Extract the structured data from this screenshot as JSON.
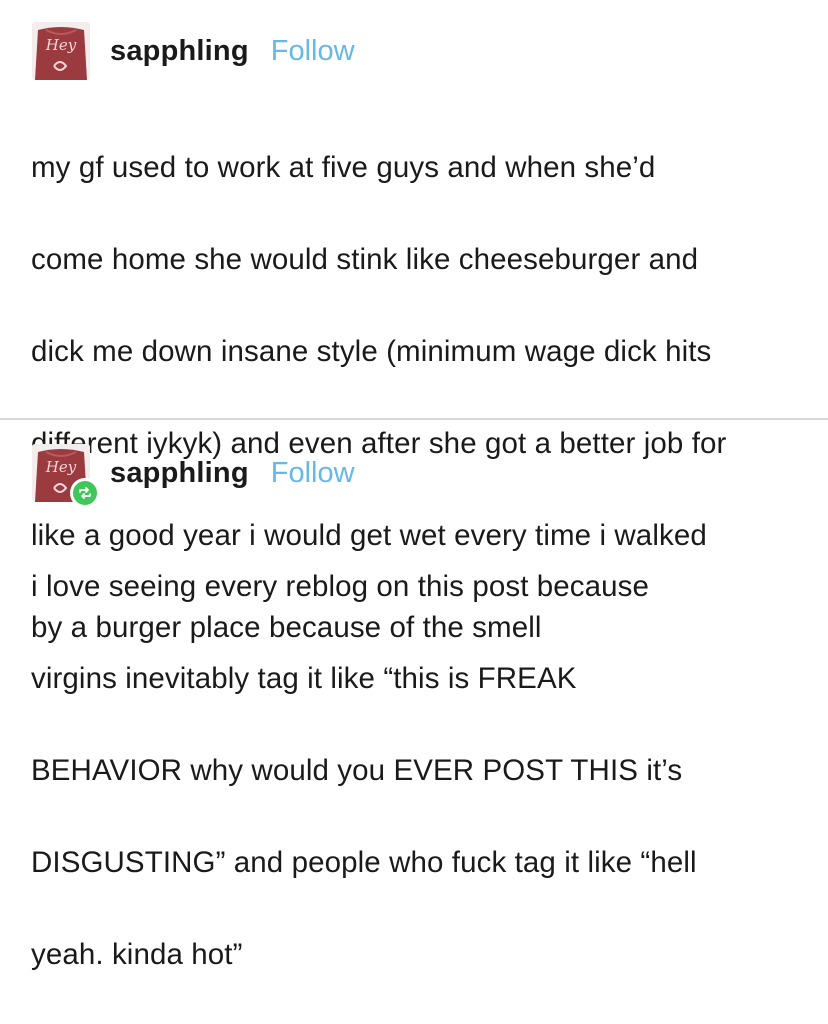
{
  "posts": [
    {
      "username": "sapphling",
      "follow_label": "Follow",
      "avatar_text": "Hey",
      "reblog": false,
      "lines": [
        "my gf used to work at five guys and when she’d",
        "come home she would stink like cheeseburger and",
        "dick me down insane style (minimum wage dick hits",
        "different iykyk) and even after she got a better job for",
        "like a good year i would get wet every time i walked",
        "by a burger place because of the smell"
      ]
    },
    {
      "username": "sapphling",
      "follow_label": "Follow",
      "avatar_text": "Hey",
      "reblog": true,
      "lines": [
        "i love seeing every reblog on this post because",
        "virgins inevitably tag it like “this is FREAK",
        "BEHAVIOR why would you EVER POST THIS it’s",
        "DISGUSTING” and people who fuck tag it like “hell",
        "yeah. kinda hot”"
      ]
    }
  ],
  "colors": {
    "follow": "#66b8e6",
    "text": "#1a1a1a",
    "divider": "#d9d9d9",
    "reblog_badge": "#3fc75a",
    "avatar_bg": "#9b3a3f"
  },
  "icons": {
    "avatar": "avatar-image",
    "reblog": "reblog-icon"
  }
}
